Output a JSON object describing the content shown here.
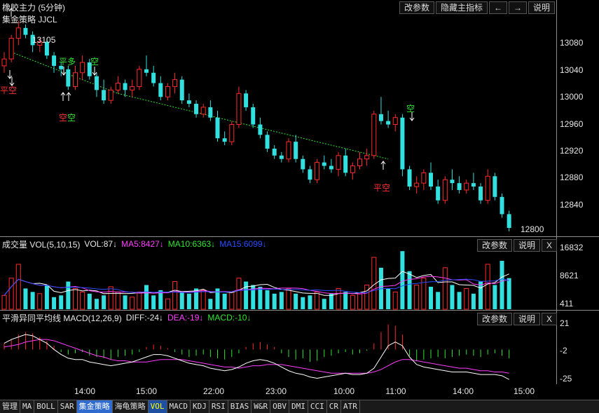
{
  "header": {
    "title": "橡胶主力 (5分钟)",
    "strategy": "集金策略 JJCL",
    "buttons": [
      "改参数",
      "隐藏主指标",
      "←",
      "→",
      "说明"
    ]
  },
  "main_axis": {
    "ticks": [
      "13080",
      "13040",
      "13000",
      "12960",
      "12920",
      "12880",
      "12840",
      "12800"
    ],
    "hi_label": "13105",
    "lo_label": "12800"
  },
  "signals": [
    {
      "text": "平空",
      "color": "#ff3030"
    },
    {
      "text": "平多",
      "color": "#2fe62f"
    },
    {
      "text": "空",
      "color": "#2fe62f"
    },
    {
      "text": "空",
      "color": "#2fe62f"
    },
    {
      "text": "平空",
      "color": "#ff3030"
    }
  ],
  "signal_double": {
    "red": "空",
    "green": "空"
  },
  "vol": {
    "label": "成交量 VOL(5,10,15)",
    "vol": "VOL:87↓",
    "ma5": "MA5:8427↓",
    "ma10": "MA10:6363↓",
    "ma15": "MA15:6099↓",
    "ticks": [
      "16832",
      "8621",
      "411"
    ],
    "buttons": [
      "改参数",
      "说明",
      "X"
    ]
  },
  "macd": {
    "label": "平滑异同平均线 MACD(12,26,9)",
    "diff": "DIFF:-24↓",
    "dea": "DEA:-19↓",
    "macd": "MACD:-10↓",
    "ticks": [
      "21",
      "-2",
      "-25"
    ],
    "buttons": [
      "改参数",
      "说明",
      "X"
    ]
  },
  "time_axis": [
    "14:00",
    "15:00",
    "22:00",
    "23:00",
    "10:00",
    "11:00",
    "14:00",
    "15:00"
  ],
  "tabs": [
    "管理",
    "MA",
    "BOLL",
    "SAR",
    "集金策略",
    "海龟策略",
    "VOL",
    "MACD",
    "KDJ",
    "RSI",
    "BIAS",
    "W&R",
    "OBV",
    "DMI",
    "CCI",
    "CR",
    "ATR"
  ],
  "active_tab": "集金策略",
  "selected_tab": "VOL",
  "colors": {
    "up": "#ff2a2a",
    "down": "#33e0e0",
    "ma5": "#ffffff",
    "ma10": "#ff3cff",
    "ma15": "#2a4cff",
    "dea": "#ff3cff",
    "diff": "#ffffff",
    "trend": "#2fe62f"
  },
  "chart_data": {
    "type": "candlestick",
    "title": "橡胶主力 (5分钟)",
    "x": [
      "14:00",
      "15:00",
      "22:00",
      "23:00",
      "10:00",
      "11:00",
      "14:00",
      "15:00"
    ],
    "ylim": [
      12800,
      13105
    ],
    "candles": [
      [
        13040,
        13060,
        13030,
        13050
      ],
      [
        13050,
        13085,
        13045,
        13080
      ],
      [
        13080,
        13105,
        13070,
        13095
      ],
      [
        13095,
        13100,
        13080,
        13085
      ],
      [
        13085,
        13090,
        13060,
        13070
      ],
      [
        13070,
        13080,
        13060,
        13075
      ],
      [
        13075,
        13080,
        13050,
        13055
      ],
      [
        13055,
        13060,
        13030,
        13040
      ],
      [
        13040,
        13045,
        13025,
        13035
      ],
      [
        13035,
        13040,
        13005,
        13010
      ],
      [
        13010,
        13040,
        13005,
        13030
      ],
      [
        13030,
        13055,
        13020,
        13045
      ],
      [
        13045,
        13050,
        13020,
        13025
      ],
      [
        13025,
        13030,
        12995,
        13005
      ],
      [
        13005,
        13020,
        12985,
        12990
      ],
      [
        12990,
        13010,
        12985,
        13005
      ],
      [
        13005,
        13025,
        13000,
        13015
      ],
      [
        13015,
        13020,
        12995,
        13005
      ],
      [
        13005,
        13020,
        12995,
        13010
      ],
      [
        13010,
        13040,
        13005,
        13035
      ],
      [
        13035,
        13055,
        13025,
        13030
      ],
      [
        13030,
        13040,
        13010,
        13015
      ],
      [
        13015,
        13025,
        12990,
        12995
      ],
      [
        12995,
        13015,
        12990,
        13010
      ],
      [
        13010,
        13030,
        13000,
        13020
      ],
      [
        13020,
        13025,
        12985,
        12990
      ],
      [
        12990,
        13000,
        12980,
        12985
      ],
      [
        12985,
        12990,
        12965,
        12970
      ],
      [
        12970,
        12985,
        12965,
        12980
      ],
      [
        12980,
        12990,
        12960,
        12965
      ],
      [
        12965,
        12975,
        12930,
        12935
      ],
      [
        12935,
        12945,
        12925,
        12930
      ],
      [
        12930,
        12960,
        12925,
        12955
      ],
      [
        12955,
        13010,
        12950,
        13000
      ],
      [
        13000,
        13005,
        12975,
        12980
      ],
      [
        12980,
        12985,
        12950,
        12955
      ],
      [
        12955,
        12965,
        12935,
        12940
      ],
      [
        12940,
        12945,
        12915,
        12920
      ],
      [
        12920,
        12925,
        12905,
        12910
      ],
      [
        12910,
        12915,
        12900,
        12905
      ],
      [
        12905,
        12935,
        12900,
        12930
      ],
      [
        12930,
        12940,
        12900,
        12905
      ],
      [
        12905,
        12910,
        12885,
        12890
      ],
      [
        12890,
        12895,
        12870,
        12875
      ],
      [
        12875,
        12905,
        12870,
        12900
      ],
      [
        12900,
        12910,
        12890,
        12895
      ],
      [
        12895,
        12905,
        12885,
        12890
      ],
      [
        12890,
        12915,
        12880,
        12910
      ],
      [
        12910,
        12920,
        12880,
        12885
      ],
      [
        12885,
        12900,
        12875,
        12895
      ],
      [
        12895,
        12915,
        12890,
        12905
      ],
      [
        12905,
        12920,
        12895,
        12910
      ],
      [
        12910,
        12975,
        12905,
        12970
      ],
      [
        12970,
        12995,
        12955,
        12960
      ],
      [
        12960,
        12975,
        12950,
        12955
      ],
      [
        12955,
        12970,
        12945,
        12965
      ],
      [
        12965,
        12970,
        12880,
        12890
      ],
      [
        12890,
        12895,
        12860,
        12865
      ],
      [
        12865,
        12880,
        12855,
        12870
      ],
      [
        12870,
        12890,
        12860,
        12885
      ],
      [
        12885,
        12900,
        12860,
        12865
      ],
      [
        12865,
        12875,
        12840,
        12845
      ],
      [
        12845,
        12880,
        12840,
        12875
      ],
      [
        12875,
        12890,
        12860,
        12870
      ],
      [
        12870,
        12880,
        12855,
        12860
      ],
      [
        12860,
        12875,
        12855,
        12870
      ],
      [
        12870,
        12885,
        12860,
        12865
      ],
      [
        12865,
        12870,
        12840,
        12845
      ],
      [
        12845,
        12890,
        12840,
        12880
      ],
      [
        12880,
        12885,
        12845,
        12850
      ],
      [
        12850,
        12855,
        12820,
        12825
      ],
      [
        12825,
        12830,
        12800,
        12805
      ]
    ],
    "volume": [
      4000,
      9000,
      13000,
      6000,
      5000,
      4500,
      7000,
      3500,
      4000,
      8000,
      6000,
      5000,
      4500,
      3000,
      4000,
      6500,
      5000,
      4000,
      3500,
      5000,
      7000,
      4000,
      5500,
      3000,
      8000,
      5000,
      4500,
      6000,
      5500,
      3000,
      6000,
      4500,
      5000,
      9000,
      8000,
      7000,
      6500,
      5500,
      4500,
      5000,
      6000,
      4500,
      3500,
      4000,
      5000,
      3000,
      4500,
      6000,
      5000,
      4000,
      4500,
      7000,
      15000,
      12000,
      6000,
      5000,
      16800,
      11000,
      7000,
      9000,
      6500,
      5000,
      12000,
      7000,
      5000,
      6000,
      4500,
      8000,
      13000,
      7000,
      14000,
      9000
    ],
    "macd_hist": [
      5,
      8,
      12,
      14,
      13,
      10,
      7,
      3,
      -2,
      -4,
      -3,
      -2,
      -5,
      -6,
      -7,
      -8,
      -6,
      -5,
      -4,
      -2,
      2,
      4,
      3,
      1,
      -2,
      -4,
      -6,
      -5,
      -4,
      -6,
      -7,
      -8,
      -6,
      -3,
      2,
      5,
      6,
      4,
      2,
      -3,
      -6,
      -8,
      -7,
      -10,
      -9,
      -6,
      -5,
      -3,
      -2,
      -4,
      -3,
      -1,
      5,
      14,
      20,
      19,
      12,
      -5,
      -9,
      -8,
      -7,
      -6,
      -7,
      -6,
      -5,
      -4,
      -5,
      -6,
      -4,
      -3,
      -5,
      -7
    ],
    "macd_diff": [
      5,
      8,
      10,
      12,
      11,
      8,
      5,
      0,
      -4,
      -7,
      -8,
      -8,
      -10,
      -11,
      -12,
      -13,
      -12,
      -11,
      -10,
      -8,
      -6,
      -4,
      -4,
      -5,
      -7,
      -9,
      -11,
      -12,
      -13,
      -15,
      -16,
      -17,
      -16,
      -14,
      -11,
      -9,
      -8,
      -9,
      -11,
      -14,
      -17,
      -19,
      -20,
      -22,
      -23,
      -22,
      -21,
      -20,
      -19,
      -20,
      -20,
      -19,
      -15,
      -6,
      3,
      6,
      3,
      -6,
      -12,
      -14,
      -15,
      -16,
      -17,
      -18,
      -18,
      -18,
      -19,
      -20,
      -20,
      -20,
      -21,
      -24
    ],
    "macd_dea": [
      2,
      3,
      4,
      6,
      7,
      8,
      8,
      7,
      5,
      3,
      1,
      -1,
      -3,
      -5,
      -6,
      -8,
      -9,
      -9,
      -10,
      -10,
      -10,
      -9,
      -8,
      -8,
      -8,
      -8,
      -9,
      -10,
      -11,
      -12,
      -13,
      -14,
      -14,
      -15,
      -14,
      -13,
      -13,
      -12,
      -12,
      -12,
      -13,
      -14,
      -15,
      -16,
      -17,
      -18,
      -19,
      -19,
      -19,
      -19,
      -19,
      -19,
      -18,
      -16,
      -13,
      -10,
      -8,
      -8,
      -9,
      -10,
      -11,
      -12,
      -13,
      -14,
      -15,
      -15,
      -16,
      -17,
      -17,
      -18,
      -18,
      -19
    ]
  }
}
